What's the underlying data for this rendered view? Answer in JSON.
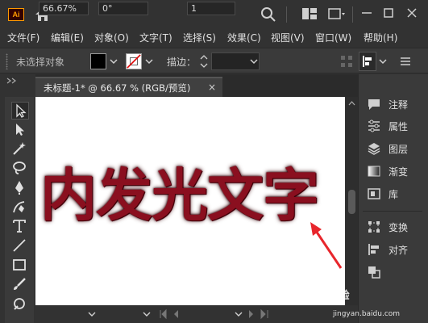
{
  "app": {
    "logo_text": "Ai",
    "accent_color": "#ff9a00"
  },
  "menu": [
    {
      "label": "文件(F)"
    },
    {
      "label": "编辑(E)"
    },
    {
      "label": "对象(O)"
    },
    {
      "label": "文字(T)"
    },
    {
      "label": "选择(S)"
    },
    {
      "label": "效果(C)"
    },
    {
      "label": "视图(V)"
    },
    {
      "label": "窗口(W)"
    },
    {
      "label": "帮助(H)"
    }
  ],
  "control": {
    "selection_label": "未选择对象",
    "stroke_label": "描边："
  },
  "document": {
    "tab_label": "未标题-1* @ 66.67 % (RGB/预览)",
    "close_symbol": "×"
  },
  "artboard": {
    "text": "内发光文字",
    "text_color": "#8a0f1f"
  },
  "status": {
    "zoom": "66.67%",
    "rotation": "0°",
    "artboard_number": "1"
  },
  "panels": [
    {
      "label": "注释",
      "icon": "comment-icon"
    },
    {
      "label": "属性",
      "icon": "properties-icon"
    },
    {
      "label": "图层",
      "icon": "layers-icon"
    },
    {
      "label": "渐变",
      "icon": "gradient-icon"
    },
    {
      "label": "库",
      "icon": "library-icon"
    },
    {
      "label": "变换",
      "icon": "transform-icon"
    },
    {
      "label": "对齐",
      "icon": "align-icon"
    }
  ],
  "watermark": {
    "brand": "Bai 经验",
    "url": "jingyan.baidu.com"
  }
}
